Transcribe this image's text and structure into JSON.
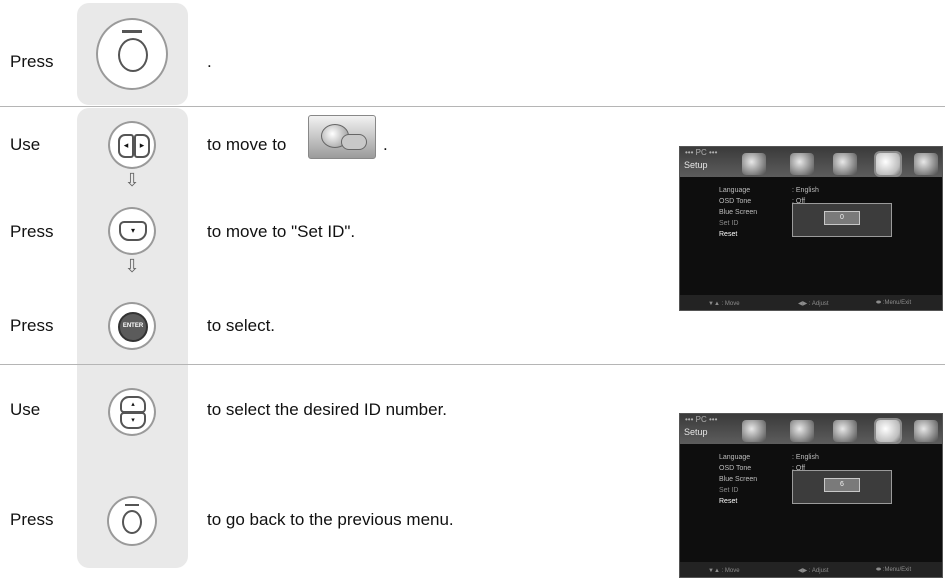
{
  "rows": [
    {
      "verb": "Press",
      "text": "."
    },
    {
      "verb": "Use",
      "text": "to move to"
    },
    {
      "verb": "Press",
      "text": "to move to \"Set ID\"."
    },
    {
      "verb": "Press",
      "text": "to select."
    },
    {
      "verb": "Use",
      "text": "to select the desired ID number."
    },
    {
      "verb": "Press",
      "text": "to go back to the previous menu."
    }
  ],
  "row2_suffix": ".",
  "osd1": {
    "source": "••• PC •••",
    "section": "Setup",
    "items": [
      {
        "label": "Language",
        "value": ": English"
      },
      {
        "label": "OSD Tone",
        "value": ": Off"
      },
      {
        "label": "Blue Screen",
        "value": ":"
      },
      {
        "label": "Set ID",
        "value": ":"
      },
      {
        "label": "Reset",
        "value": ": »"
      }
    ],
    "id_value": "0",
    "hints": [
      "▼▲ : Move",
      "◀▶ : Adjust",
      "⬬ :Menu/Exit"
    ]
  },
  "osd2": {
    "source": "••• PC •••",
    "section": "Setup",
    "items": [
      {
        "label": "Language",
        "value": ": English"
      },
      {
        "label": "OSD Tone",
        "value": ": Off"
      },
      {
        "label": "Blue Screen",
        "value": ":"
      },
      {
        "label": "Set ID",
        "value": ":"
      },
      {
        "label": "Reset",
        "value": ": »"
      }
    ],
    "id_value": "6",
    "hints": [
      "▼▲ : Move",
      "◀▶ : Adjust",
      "⬬ :Menu/Exit"
    ]
  },
  "enter_label": "ENTER",
  "icons": {
    "menu": "menu-button-icon",
    "leftright": "left-right-button-icon",
    "down": "down-button-icon",
    "enter": "enter-button-icon",
    "updown": "up-down-button-icon",
    "setup_menu": "setup-menu-icon",
    "arrow": "down-arrow-icon"
  }
}
